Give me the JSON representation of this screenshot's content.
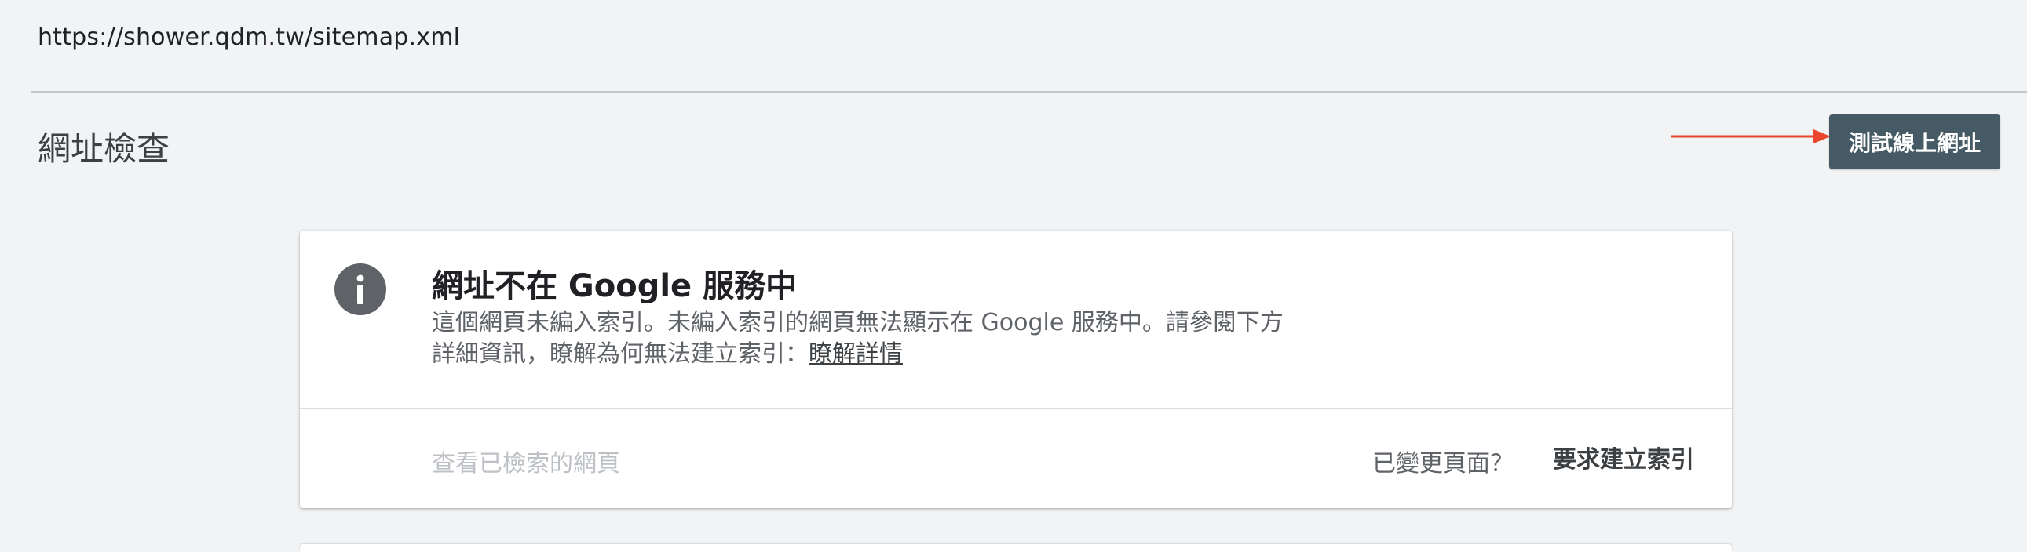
{
  "url_bar": {
    "url": "https://shower.qdm.tw/sitemap.xml"
  },
  "header": {
    "title": "網址檢查",
    "test_live_label": "測試線上網址"
  },
  "status_card": {
    "icon": "info-icon",
    "title": "網址不在 Google 服務中",
    "description_line1": "這個網頁未編入索引。未編入索引的網頁無法顯示在 Google 服務中。請參閱下方",
    "description_line2": "詳細資訊，瞭解為何無法建立索引：",
    "learn_more_label": "瞭解詳情",
    "view_crawled_label": "查看已檢索的網頁",
    "changed_page_text": "已變更頁面？",
    "request_index_label": "要求建立索引"
  },
  "colors": {
    "background": "#f1f3f4",
    "button_bg": "#455a64",
    "arrow": "#e8472e",
    "icon": "#5f6368"
  }
}
